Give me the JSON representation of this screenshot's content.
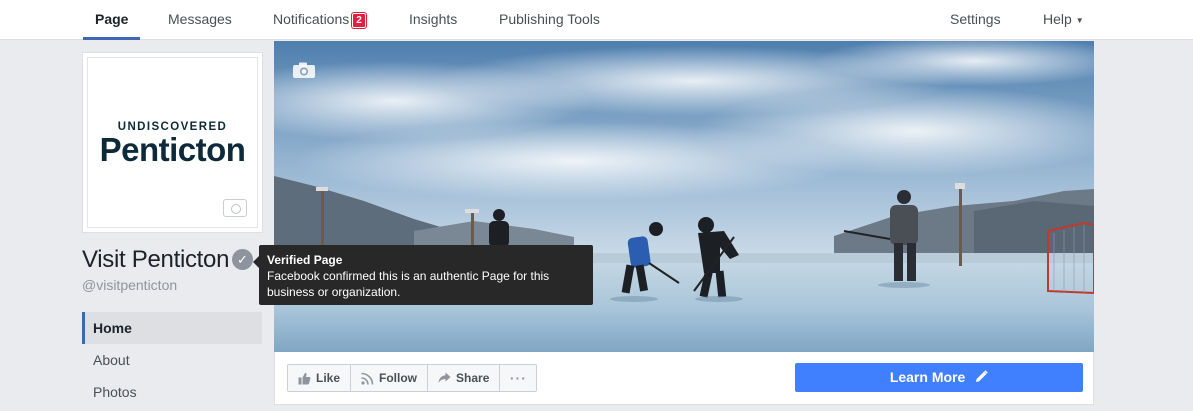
{
  "nav": {
    "items": [
      {
        "label": "Page",
        "active": true
      },
      {
        "label": "Messages"
      },
      {
        "label": "Notifications",
        "badge": "2"
      },
      {
        "label": "Insights"
      },
      {
        "label": "Publishing Tools"
      }
    ],
    "right": {
      "settings": "Settings",
      "help": "Help"
    }
  },
  "profile": {
    "logo_line1": "UNDISCOVERED",
    "logo_line2": "Penticton",
    "name": "Visit Penticton",
    "handle": "@visitpenticton"
  },
  "tooltip": {
    "title": "Verified Page",
    "body": "Facebook confirmed this is an authentic Page for this business or organization."
  },
  "side_nav": {
    "items": [
      {
        "label": "Home",
        "active": true
      },
      {
        "label": "About"
      },
      {
        "label": "Photos"
      }
    ]
  },
  "actions": {
    "like": "Like",
    "follow": "Follow",
    "share": "Share",
    "more": "···",
    "learn_more": "Learn More"
  },
  "colors": {
    "brand_blue": "#4267b2",
    "cta_blue": "#4080ff",
    "badge_red": "#e41e3f"
  }
}
